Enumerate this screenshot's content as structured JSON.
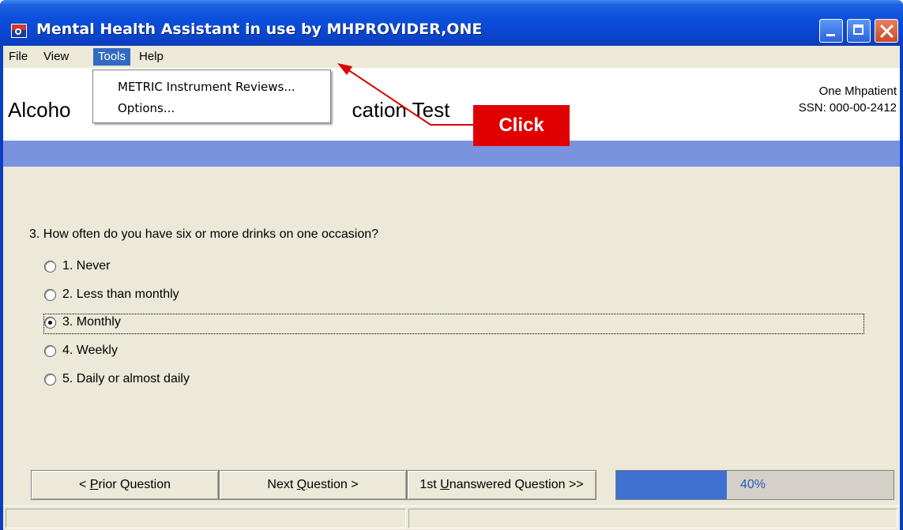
{
  "window": {
    "title": "Mental Health Assistant in use by MHPROVIDER,ONE"
  },
  "menu": [
    "File",
    "View",
    "Tools",
    "Help"
  ],
  "tools_menu": [
    "METRIC Instrument Reviews...",
    "Options..."
  ],
  "header": {
    "title_left": "Alcoho",
    "title_right": "cation Test",
    "patient_name": "One Mhpatient",
    "patient_ssn": "SSN: 000-00-2412"
  },
  "question": {
    "text": "3. How often do you have six or more drinks on one occasion?",
    "options": [
      "1. Never",
      "2. Less than monthly",
      "3. Monthly",
      "4. Weekly",
      "5. Daily or almost daily"
    ],
    "selected_index": 2
  },
  "buttons": {
    "prior": "< Prior Question",
    "next": "Next Question >",
    "unanswered": "1st Unanswered Question >>"
  },
  "progress": {
    "value": 0.4,
    "label": "40%"
  },
  "annotation": {
    "text": "Click",
    "color": "#e00000"
  },
  "colors": {
    "titlebar": "#0b4fdb",
    "menu_highlight": "#316ac5",
    "band": "#7b93de",
    "progress_fill": "#3e6fd1"
  }
}
